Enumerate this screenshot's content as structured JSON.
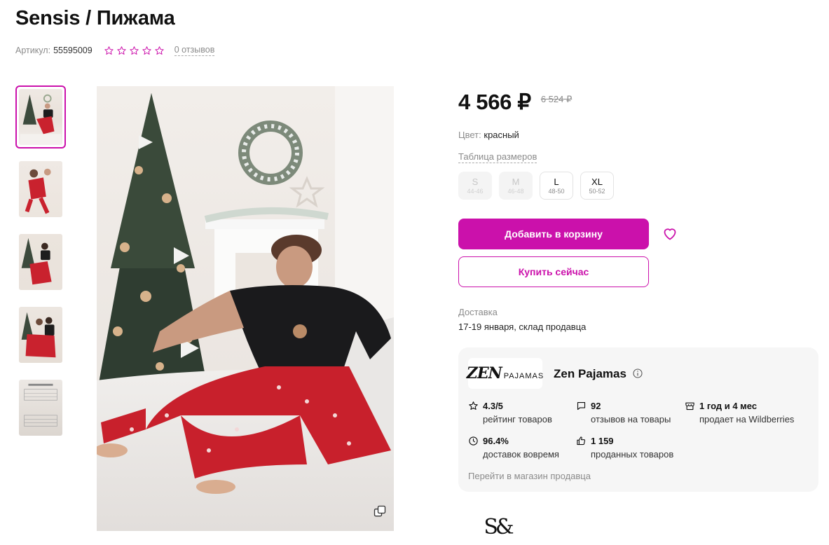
{
  "product": {
    "title": "Sensis / Пижама",
    "article_label": "Артикул:",
    "article_value": "55595009",
    "rating_stars": 0,
    "reviews_label": "0 отзывов"
  },
  "price": {
    "current": "4 566 ₽",
    "old": "6 524 ₽"
  },
  "color": {
    "label": "Цвет:",
    "value": "красный"
  },
  "size_table_label": "Таблица размеров",
  "sizes": [
    {
      "name": "S",
      "range": "44-46",
      "available": false
    },
    {
      "name": "M",
      "range": "46-48",
      "available": false
    },
    {
      "name": "L",
      "range": "48-50",
      "available": true
    },
    {
      "name": "XL",
      "range": "50-52",
      "available": true
    }
  ],
  "buttons": {
    "add_to_cart": "Добавить в корзину",
    "buy_now": "Купить сейчас"
  },
  "delivery": {
    "label": "Доставка",
    "value": "17-19 января, склад продавца"
  },
  "seller": {
    "logo_text_main": "ZEN",
    "logo_text_sub": "PAJAMAS",
    "name": "Zen Pajamas",
    "stats": [
      {
        "icon": "star-icon",
        "value": "4.3/5",
        "label": "рейтинг товаров"
      },
      {
        "icon": "comment-icon",
        "value": "92",
        "label": "отзывов на товары"
      },
      {
        "icon": "store-icon",
        "value": "1 год и 4 мес",
        "label": "продает на Wildberries"
      },
      {
        "icon": "clock-icon",
        "value": "96.4%",
        "label": "доставок вовремя"
      },
      {
        "icon": "thumbs-up-icon",
        "value": "1 159",
        "label": "проданных товаров"
      }
    ],
    "shop_link": "Перейти в магазин продавца"
  },
  "brand_logo_text": "S&",
  "colors": {
    "accent": "#cb11ab",
    "muted": "#8b8b8b",
    "card_bg": "#f6f6f6"
  }
}
